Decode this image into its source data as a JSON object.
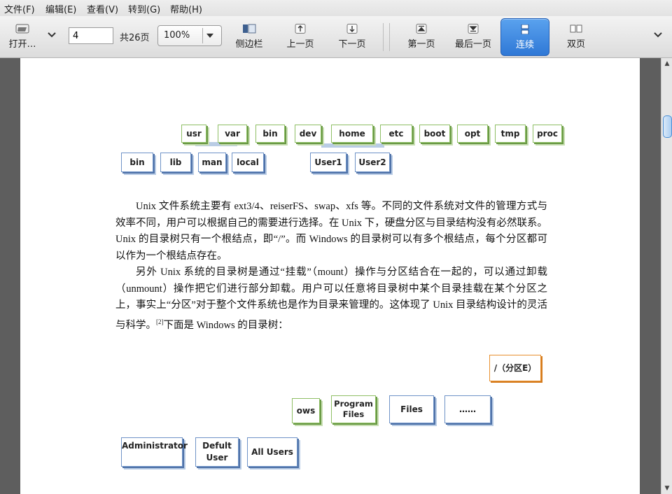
{
  "menubar": {
    "items": [
      "文件(F)",
      "编辑(E)",
      "查看(V)",
      "转到(G)",
      "帮助(H)"
    ]
  },
  "toolbar": {
    "open_label": "打开…",
    "page_value": "4",
    "page_total": "共26页",
    "zoom_value": "100%",
    "sidebar_label": "侧边栏",
    "prev_label": "上一页",
    "next_label": "下一页",
    "first_label": "第一页",
    "last_label": "最后一页",
    "continuous_label": "连续",
    "dual_label": "双页"
  },
  "document": {
    "unix_tree": {
      "row1": [
        "usr",
        "var",
        "bin",
        "dev",
        "home",
        "etc",
        "boot",
        "opt",
        "tmp",
        "proc"
      ],
      "row2": [
        "bin",
        "lib",
        "man",
        "local",
        "User1",
        "User2"
      ]
    },
    "paragraph1": "Unix 文件系统主要有 ext3/4、reiserFS、swap、xfs 等。不同的文件系统对文件的管理方式与效率不同，用户可以根据自己的需要进行选择。在 Unix 下，硬盘分区与目录结构没有必然联系。Unix 的目录树只有一个根结点，即“/”。而 Windows 的目录树可以有多个根结点，每个分区都可以作为一个根结点存在。",
    "paragraph2_main": "另外 Unix 系统的目录树是通过“挂载”（mount）操作与分区结合在一起的，可以通过卸载（unmount）操作把它们进行部分卸载。用户可以任意将目录树中某个目录挂载在某个分区之上，事实上“分区”对于整个文件系统也是作为目录来管理的。这体现了 Unix 目录结构设计的灵活与科学。",
    "citation": "[2]",
    "paragraph2_tail": "下面是 Windows 的目录树：",
    "win_tree": {
      "partition": "/（分区E）",
      "row1": [
        "ows",
        "Program Files",
        "Files",
        "……"
      ],
      "row2": [
        "Administrator",
        "Defult User",
        "All Users"
      ]
    }
  }
}
